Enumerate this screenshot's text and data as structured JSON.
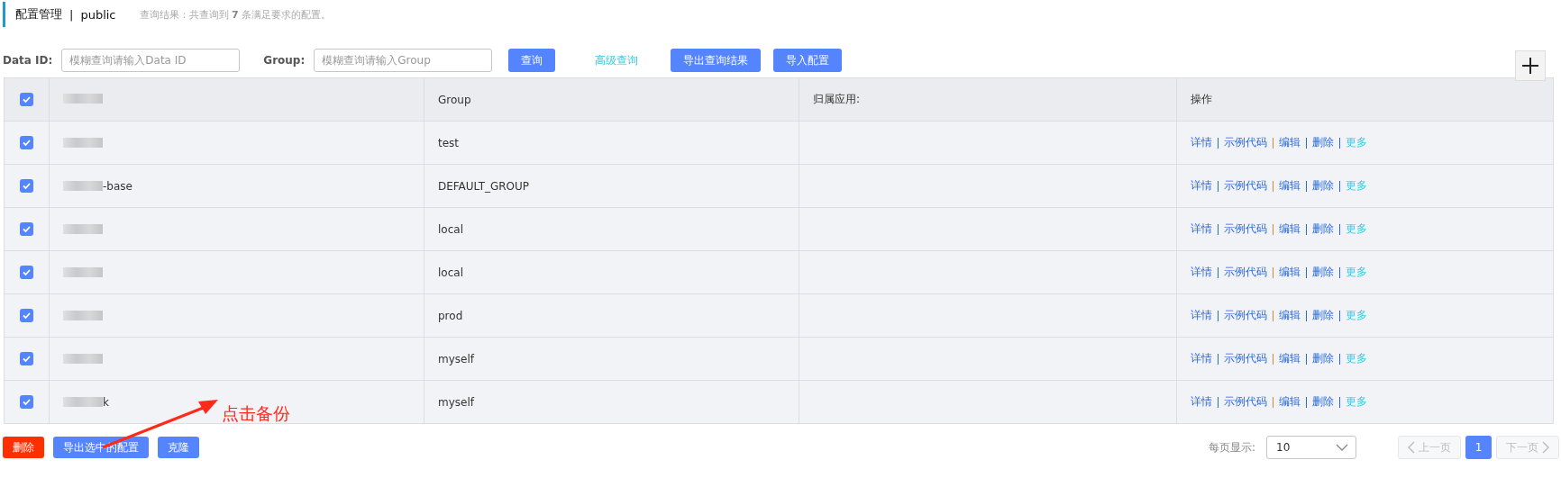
{
  "header": {
    "title": "配置管理",
    "separator": "|",
    "namespace": "public",
    "summary": "查询结果：共查询到 **7** 条满足要求的配置。"
  },
  "filters": [
    {
      "label": "Data ID:",
      "placeholder": "模糊查询请输入Data ID"
    },
    {
      "label": "Group:",
      "placeholder": "模糊查询请输入Group"
    }
  ],
  "toolbar": [
    {
      "kind": "primary",
      "label": "查询"
    },
    {
      "kind": "link",
      "label": "高级查询"
    },
    {
      "kind": "primary",
      "label": "导出查询结果"
    },
    {
      "kind": "primary",
      "label": "导入配置"
    }
  ],
  "table": {
    "select_all_checked": true,
    "columns": [
      {
        "kind": "redacted"
      },
      {
        "kind": "text",
        "label": "Group"
      },
      {
        "kind": "text",
        "label": "归属应用:"
      },
      {
        "kind": "text",
        "label": "操作"
      }
    ],
    "rows": [
      {
        "checked": true,
        "group": "test",
        "actions": [
          {
            "kind": "link",
            "label": "详情"
          },
          {
            "kind": "link",
            "label": "示例代码"
          },
          {
            "kind": "link",
            "label": "编辑"
          },
          {
            "kind": "link",
            "label": "删除"
          },
          {
            "kind": "more",
            "label": "更多"
          }
        ]
      },
      {
        "checked": true,
        "data_id_tail": "-base",
        "group": "DEFAULT_GROUP",
        "actions": [
          {
            "kind": "link",
            "label": "详情"
          },
          {
            "kind": "link",
            "label": "示例代码"
          },
          {
            "kind": "link",
            "label": "编辑"
          },
          {
            "kind": "link",
            "label": "删除"
          },
          {
            "kind": "more",
            "label": "更多"
          }
        ]
      },
      {
        "checked": true,
        "group": "local",
        "actions": [
          {
            "kind": "link",
            "label": "详情"
          },
          {
            "kind": "link",
            "label": "示例代码"
          },
          {
            "kind": "link",
            "label": "编辑"
          },
          {
            "kind": "link",
            "label": "删除"
          },
          {
            "kind": "more",
            "label": "更多"
          }
        ]
      },
      {
        "checked": true,
        "group": "local",
        "actions": [
          {
            "kind": "link",
            "label": "详情"
          },
          {
            "kind": "link",
            "label": "示例代码"
          },
          {
            "kind": "link",
            "label": "编辑"
          },
          {
            "kind": "link",
            "label": "删除"
          },
          {
            "kind": "more",
            "label": "更多"
          }
        ]
      },
      {
        "checked": true,
        "group": "prod",
        "actions": [
          {
            "kind": "link",
            "label": "详情"
          },
          {
            "kind": "link",
            "label": "示例代码"
          },
          {
            "kind": "link",
            "label": "编辑"
          },
          {
            "kind": "link",
            "label": "删除"
          },
          {
            "kind": "more",
            "label": "更多"
          }
        ]
      },
      {
        "checked": true,
        "group": "myself",
        "actions": [
          {
            "kind": "link",
            "label": "详情"
          },
          {
            "kind": "link",
            "label": "示例代码"
          },
          {
            "kind": "link",
            "label": "编辑"
          },
          {
            "kind": "link",
            "label": "删除"
          },
          {
            "kind": "more",
            "label": "更多"
          }
        ]
      },
      {
        "checked": true,
        "data_id_tail": "k",
        "group": "myself",
        "actions": [
          {
            "kind": "link",
            "label": "详情"
          },
          {
            "kind": "link",
            "label": "示例代码"
          },
          {
            "kind": "link",
            "label": "编辑"
          },
          {
            "kind": "link",
            "label": "删除"
          },
          {
            "kind": "more",
            "label": "更多"
          }
        ]
      }
    ]
  },
  "bulk_actions": [
    {
      "kind": "danger",
      "label": "删除"
    },
    {
      "kind": "primary",
      "label": "导出选中的配置"
    },
    {
      "kind": "primary",
      "label": "克隆"
    }
  ],
  "pagination": {
    "page_size_label": "每页显示:",
    "page_size": "10",
    "prev": "上一页",
    "prev_disabled": true,
    "pages": [
      {
        "label": "1",
        "selected": true
      }
    ],
    "next": "下一页",
    "next_disabled": true
  },
  "annotation": {
    "text": "点击备份"
  }
}
